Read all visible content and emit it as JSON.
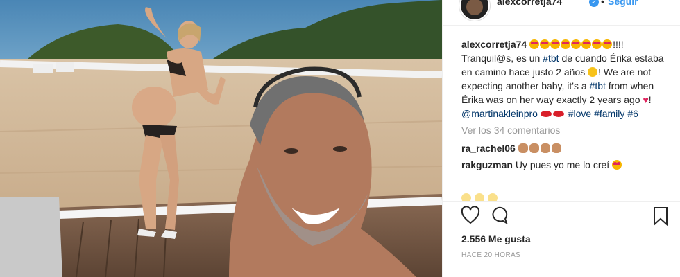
{
  "post": {
    "username": "alexcorretja74",
    "verified_icon": "verified-badge-icon",
    "separator": "•",
    "follow_label": "Seguir",
    "photo_description": "selfie-on-beach-deck"
  },
  "caption": {
    "username": "alexcorretja74",
    "emoji_run_count": 8,
    "exclaim": "!!!!",
    "text_1": "Tranquil@s, es un ",
    "tag_tbt_1": "#tbt",
    "text_2": " de cuando Érika estaba en camino hace justo 2 años ",
    "text_3": "! We are not expecting another baby, it's a ",
    "tag_tbt_2": "#tbt",
    "text_4": " from when Érika was on her way exactly 2 years ago ",
    "text_5": "! ",
    "mention": "@martinakleinpro",
    "tag_love": "#love",
    "tag_family": "#family",
    "tag_6": "#6"
  },
  "view_all_comments": "Ver los 34 comentarios",
  "comments": [
    {
      "username": "ra_rachel06",
      "text": ""
    },
    {
      "username": "rakguzman",
      "text": "Uy pues yo me lo creí"
    }
  ],
  "actions": {
    "like_icon": "heart-outline-icon",
    "comment_icon": "comment-bubble-icon",
    "save_icon": "bookmark-icon"
  },
  "likes": "2.556 Me gusta",
  "timestamp": "HACE 20 HORAS"
}
